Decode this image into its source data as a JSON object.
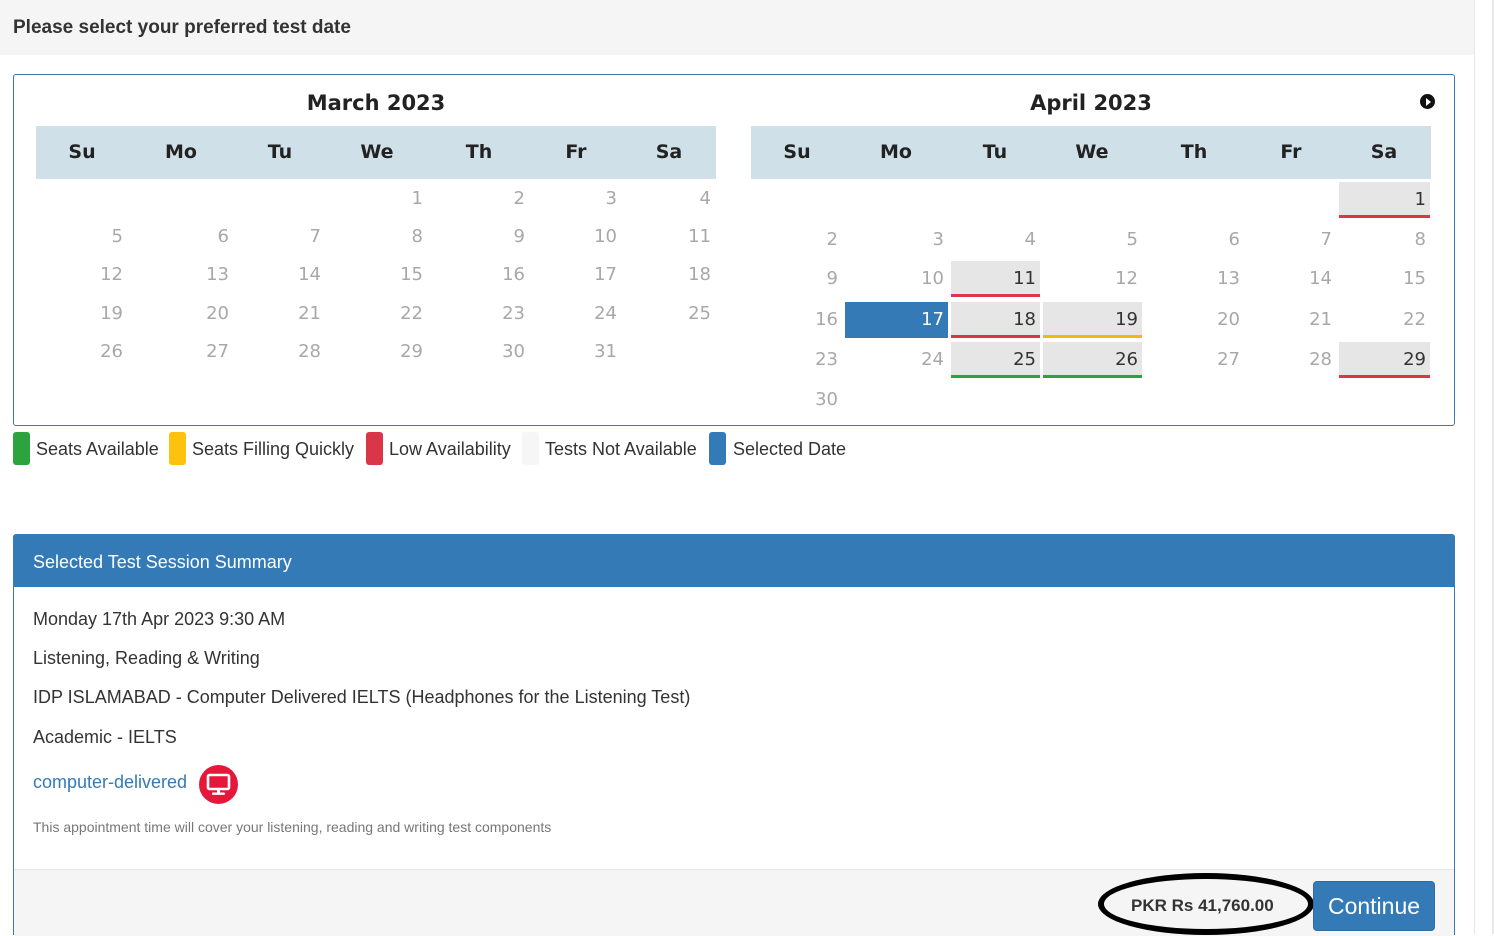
{
  "header": {
    "title": "Please select your preferred test date"
  },
  "calendar": {
    "weekdays": [
      "Su",
      "Mo",
      "Tu",
      "We",
      "Th",
      "Fr",
      "Sa"
    ],
    "months": [
      {
        "title": "March 2023",
        "first_weekday": 3,
        "num_days": 31,
        "days": {}
      },
      {
        "title": "April 2023",
        "first_weekday": 6,
        "num_days": 30,
        "days": {
          "1": "red",
          "11": "red",
          "17": "selected",
          "18": "red",
          "19": "yellow",
          "25": "green",
          "26": "green",
          "29": "red"
        }
      }
    ]
  },
  "legend": [
    {
      "label": "Seats Available",
      "color": "#2ca33e"
    },
    {
      "label": "Seats Filling Quickly",
      "color": "#fcc20d"
    },
    {
      "label": "Low Availability",
      "color": "#d9364a"
    },
    {
      "label": "Tests Not Available",
      "color": "#f6f6f6"
    },
    {
      "label": "Selected Date",
      "color": "#337ab7"
    }
  ],
  "summary": {
    "title": "Selected Test Session Summary",
    "datetime": "Monday 17th Apr 2023 9:30 AM",
    "modules": "Listening, Reading & Writing",
    "venue": "IDP ISLAMABAD - Computer Delivered IELTS (Headphones for the Listening Test)",
    "test_type": "Academic - IELTS",
    "delivery_link": "computer-delivered",
    "note": "This appointment time will cover your listening, reading and writing test components",
    "price": "PKR Rs 41,760.00",
    "continue_label": "Continue"
  }
}
